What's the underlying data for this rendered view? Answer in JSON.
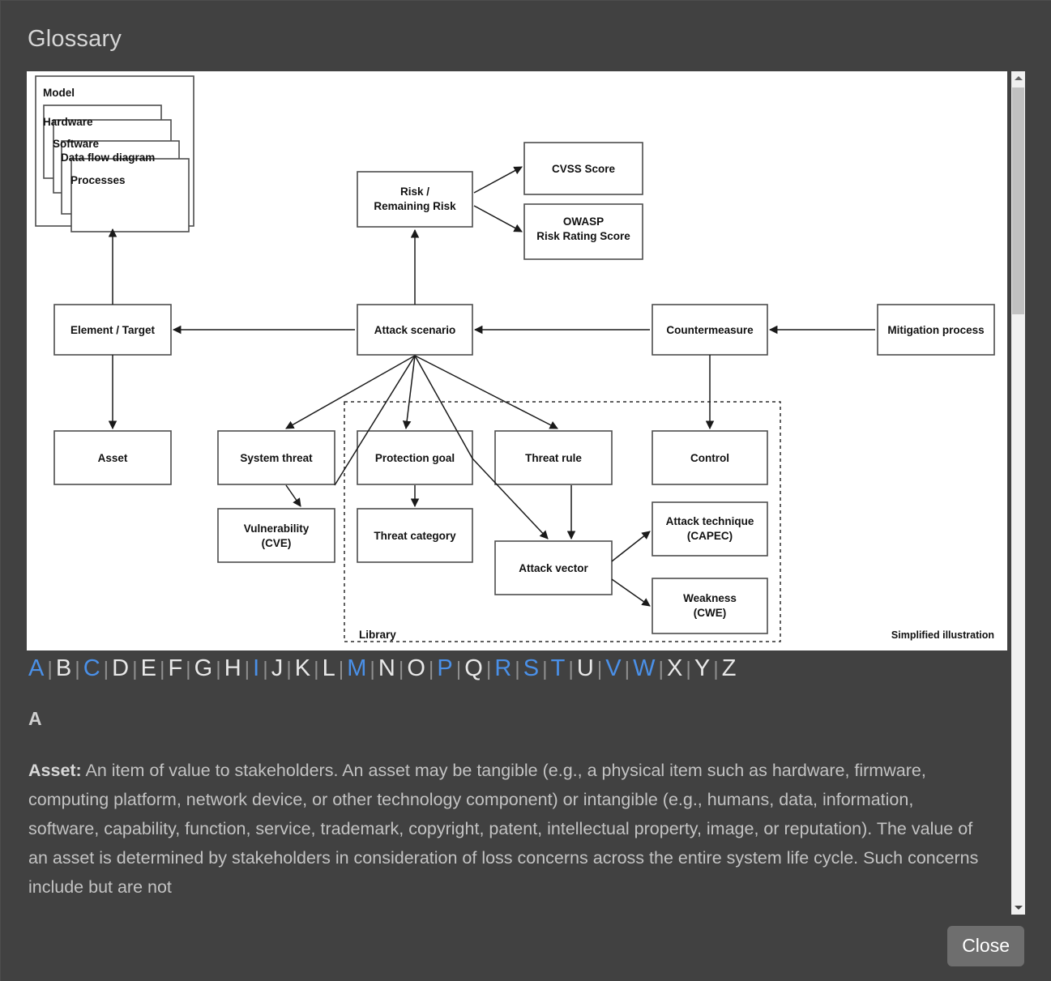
{
  "dialog": {
    "title": "Glossary",
    "close_label": "Close"
  },
  "scrollbar": {
    "up_arrow": "scroll-up-arrow",
    "down_arrow": "scroll-down-arrow"
  },
  "diagram": {
    "caption": "Simplified illustration",
    "library_label": "Library",
    "nodes": {
      "model": "Model",
      "hardware": "Hardware",
      "software": "Software",
      "data_flow_diagram": "Data flow diagram",
      "processes": "Processes",
      "risk": "Risk /\nRemaining Risk",
      "risk_line1": "Risk /",
      "risk_line2": "Remaining Risk",
      "cvss": "CVSS Score",
      "owasp_line1": "OWASP",
      "owasp_line2": "Risk Rating Score",
      "element_target": "Element / Target",
      "attack_scenario": "Attack scenario",
      "countermeasure": "Countermeasure",
      "mitigation_process": "Mitigation process",
      "asset": "Asset",
      "system_threat": "System threat",
      "protection_goal": "Protection goal",
      "threat_rule": "Threat rule",
      "control": "Control",
      "vulnerability_line1": "Vulnerability",
      "vulnerability_line2": "(CVE)",
      "threat_category": "Threat category",
      "attack_vector": "Attack vector",
      "attack_technique_line1": "Attack technique",
      "attack_technique_line2": "(CAPEC)",
      "weakness_line1": "Weakness",
      "weakness_line2": "(CWE)"
    }
  },
  "alphabet": [
    {
      "letter": "A",
      "active": true
    },
    {
      "letter": "B",
      "active": false
    },
    {
      "letter": "C",
      "active": true
    },
    {
      "letter": "D",
      "active": false
    },
    {
      "letter": "E",
      "active": false
    },
    {
      "letter": "F",
      "active": false
    },
    {
      "letter": "G",
      "active": false
    },
    {
      "letter": "H",
      "active": false
    },
    {
      "letter": "I",
      "active": true
    },
    {
      "letter": "J",
      "active": false
    },
    {
      "letter": "K",
      "active": false
    },
    {
      "letter": "L",
      "active": false
    },
    {
      "letter": "M",
      "active": true
    },
    {
      "letter": "N",
      "active": false
    },
    {
      "letter": "O",
      "active": false
    },
    {
      "letter": "P",
      "active": true
    },
    {
      "letter": "Q",
      "active": false
    },
    {
      "letter": "R",
      "active": true
    },
    {
      "letter": "S",
      "active": true
    },
    {
      "letter": "T",
      "active": true
    },
    {
      "letter": "U",
      "active": false
    },
    {
      "letter": "V",
      "active": true
    },
    {
      "letter": "W",
      "active": true
    },
    {
      "letter": "X",
      "active": false
    },
    {
      "letter": "Y",
      "active": false
    },
    {
      "letter": "Z",
      "active": false
    }
  ],
  "content": {
    "section_heading": "A",
    "entry_term": "Asset:",
    "entry_text": " An item of value to stakeholders. An asset may be tangible (e.g., a physical item such as hardware, firmware, computing platform, network device, or other technology component) or intangible (e.g., humans, data, information, software, capability, function, service, trademark, copyright, patent, intellectual property, image, or reputation). The value of an asset is determined by stakeholders in consideration of loss concerns across the entire system life cycle. Such concerns include but are not"
  },
  "colors": {
    "background": "#414141",
    "panel": "#ffffff",
    "link": "#4a90e8",
    "text": "#c3c3c3",
    "button": "#6e6e6e"
  }
}
